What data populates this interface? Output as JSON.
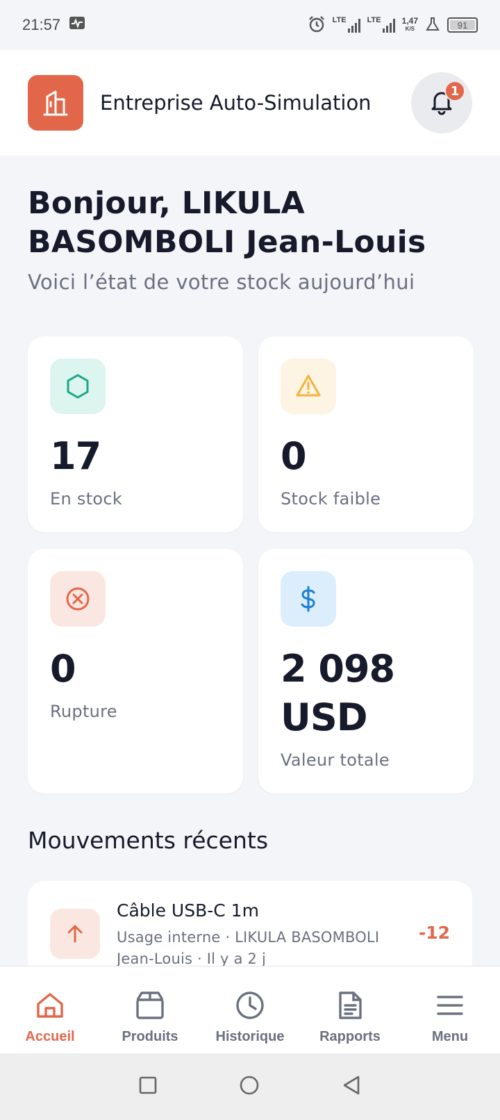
{
  "status_bar": {
    "time": "21:57",
    "lte1": "LTE",
    "lte2": "LTE",
    "speed_value": "1,47",
    "speed_unit": "K/S",
    "battery": "91"
  },
  "header": {
    "company_name": "Entreprise Auto-Simulation",
    "notification_count": "1",
    "logo_icon": "building-icon",
    "bell_icon": "bell-icon"
  },
  "greeting": {
    "title": "Bonjour, LIKULA BASOMBOLI Jean-Louis",
    "subtitle": "Voici l’état de votre stock aujourd’hui"
  },
  "stats": [
    {
      "value": "17",
      "label": "En stock",
      "icon": "hexagon-icon",
      "color": "#1aa68a",
      "bg": "#dcf5ef"
    },
    {
      "value": "0",
      "label": "Stock faible",
      "icon": "warning-icon",
      "color": "#f2b33d",
      "bg": "#fdf4e3"
    },
    {
      "value": "0",
      "label": "Rupture",
      "icon": "x-circle-icon",
      "color": "#e2674a",
      "bg": "#fbe7e2"
    },
    {
      "value": "2 098 USD",
      "label": "Valeur totale",
      "icon": "dollar-icon",
      "color": "#1c7fd0",
      "bg": "#dcedfb"
    }
  ],
  "recent": {
    "title": "Mouvements récents",
    "items": [
      {
        "name": "Câble USB-C 1m",
        "subtitle": "Usage interne · LIKULA BASOMBOLI Jean-Louis · Il y a 2 j",
        "quantity": "-12",
        "icon": "arrow-up-icon"
      }
    ]
  },
  "nav": [
    {
      "label": "Accueil",
      "icon": "home-icon",
      "active": true
    },
    {
      "label": "Produits",
      "icon": "box-icon",
      "active": false
    },
    {
      "label": "Historique",
      "icon": "clock-icon",
      "active": false
    },
    {
      "label": "Rapports",
      "icon": "document-icon",
      "active": false
    },
    {
      "label": "Menu",
      "icon": "menu-icon",
      "active": false
    }
  ],
  "colors": {
    "accent": "#e2674a",
    "text": "#161a2b",
    "muted": "#6b7080",
    "background": "#f4f5f8"
  }
}
